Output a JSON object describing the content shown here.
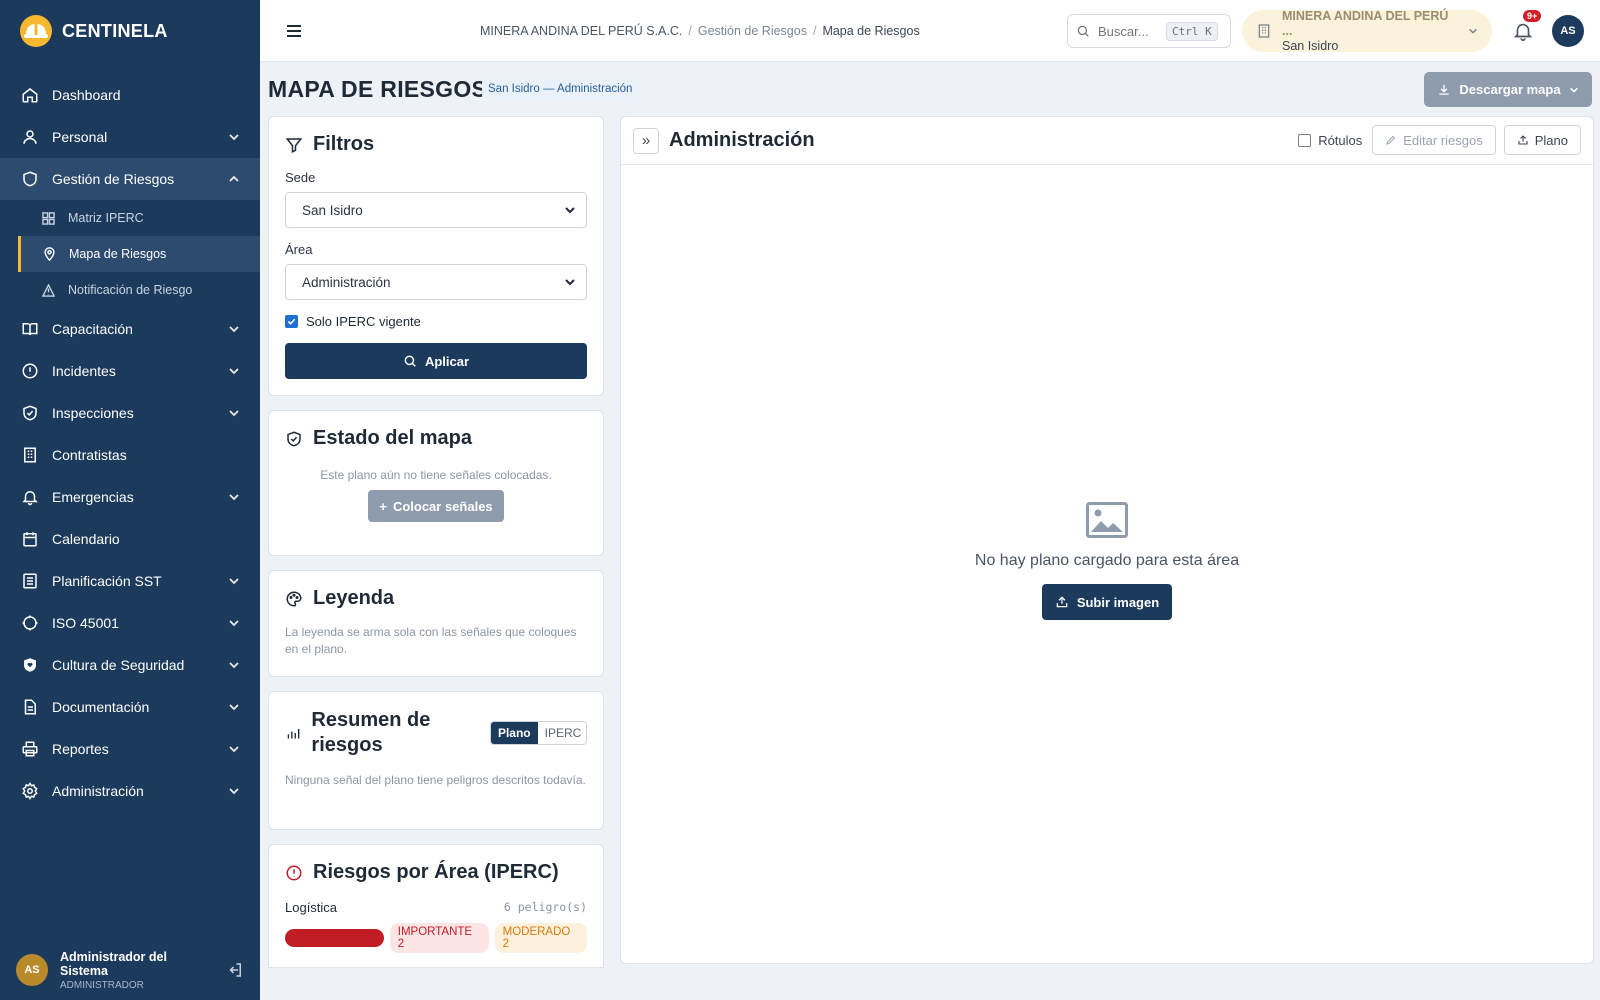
{
  "app": {
    "brand": "CENTINELA"
  },
  "sidebar": {
    "items": [
      {
        "label": "Dashboard",
        "icon": "home-icon"
      },
      {
        "label": "Personal",
        "icon": "user-icon"
      },
      {
        "label": "Gestión de Riesgos",
        "icon": "shield-icon"
      },
      {
        "label": "Capacitación",
        "icon": "book-icon"
      },
      {
        "label": "Incidentes",
        "icon": "alert-circle-icon"
      },
      {
        "label": "Inspecciones",
        "icon": "shield-check-icon"
      },
      {
        "label": "Contratistas",
        "icon": "building-icon"
      },
      {
        "label": "Emergencias",
        "icon": "bell-icon"
      },
      {
        "label": "Calendario",
        "icon": "calendar-icon"
      },
      {
        "label": "Planificación SST",
        "icon": "list-icon"
      },
      {
        "label": "ISO 45001",
        "icon": "badge-icon"
      },
      {
        "label": "Cultura de Seguridad",
        "icon": "shield-heart-icon"
      },
      {
        "label": "Documentación",
        "icon": "file-icon"
      },
      {
        "label": "Reportes",
        "icon": "printer-icon"
      },
      {
        "label": "Administración",
        "icon": "gear-icon"
      }
    ],
    "subitems": [
      {
        "label": "Matriz IPERC",
        "icon": "grid-icon"
      },
      {
        "label": "Mapa de Riesgos",
        "icon": "map-pin-icon"
      },
      {
        "label": "Notificación de Riesgo",
        "icon": "warning-icon"
      }
    ],
    "user": {
      "initials": "AS",
      "name": "Administrador del Sistema",
      "role": "ADMINISTRADOR"
    }
  },
  "topbar": {
    "breadcrumb": [
      "MINERA ANDINA DEL PERÚ S.A.C.",
      "Gestión de Riesgos",
      "Mapa de Riesgos"
    ],
    "search_placeholder": "Buscar...",
    "search_shortcut": "Ctrl K",
    "company_name": "MINERA ANDINA DEL PERÚ ...",
    "company_site": "San Isidro",
    "notifications": "9+",
    "user_initials": "AS"
  },
  "page": {
    "title": "MAPA DE RIESGOS",
    "subtitle": "San Isidro — Administración",
    "download_label": "Descargar mapa"
  },
  "filters": {
    "title": "Filtros",
    "sede_label": "Sede",
    "sede_value": "San Isidro",
    "area_label": "Área",
    "area_value": "Administración",
    "checkbox_label": "Solo IPERC vigente",
    "apply_label": "Aplicar"
  },
  "map_state": {
    "title": "Estado del mapa",
    "text": "Este plano aún no tiene señales colocadas.",
    "button": "Colocar señales"
  },
  "legend": {
    "title": "Leyenda",
    "text": "La leyenda se arma sola con las señales que coloques en el plano."
  },
  "summary": {
    "title": "Resumen de riesgos",
    "seg_plano": "Plano",
    "seg_iperc": "IPERC",
    "text": "Ninguna señal del plano tiene peligros descritos todavía."
  },
  "by_area": {
    "title": "Riesgos por Área (IPERC)",
    "rows": [
      {
        "area": "Logística",
        "count": "6 peligro(s)",
        "importante": "IMPORTANTE 2",
        "moderado": "MODERADO 2"
      }
    ]
  },
  "map_panel": {
    "title": "Administración",
    "labels_toggle": "Rótulos",
    "edit_label": "Editar riesgos",
    "plan_label": "Plano",
    "empty_text": "No hay plano cargado para esta área",
    "upload_label": "Subir imagen"
  },
  "colors": {
    "sidebar": "#1c3a5b",
    "accent": "#f5b82e",
    "danger": "#c01d24"
  }
}
